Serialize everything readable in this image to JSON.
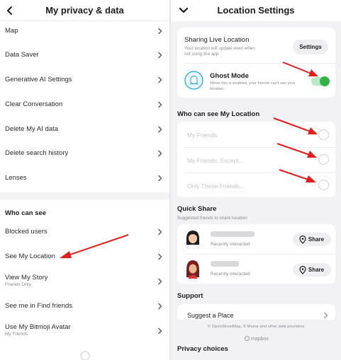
{
  "left": {
    "title": "My privacy & data",
    "items": [
      {
        "label": "Map"
      },
      {
        "label": "Data Saver"
      },
      {
        "label": "Generative AI Settings"
      },
      {
        "label": "Clear Conversation"
      },
      {
        "label": "Delete My AI data"
      },
      {
        "label": "Delete search history"
      },
      {
        "label": "Lenses"
      }
    ],
    "section_title": "Who can see",
    "who_items": [
      {
        "label": "Blocked users",
        "sub": ""
      },
      {
        "label": "See My Location",
        "sub": ""
      },
      {
        "label": "View My Story",
        "sub": "Friends Only"
      },
      {
        "label": "See me in Find friends",
        "sub": ""
      },
      {
        "label": "Use My Bitmoji Avatar",
        "sub": "My Friends"
      }
    ]
  },
  "right": {
    "title": "Location Settings",
    "sharing": {
      "title": "Sharing Live Location",
      "desc": "Your location will update even when not using the app",
      "button": "Settings"
    },
    "ghost": {
      "title": "Ghost Mode",
      "desc": "When this is enabled, your friends can't see your location.",
      "enabled": true
    },
    "who_section": "Who can see My Location",
    "options": [
      "My Friends",
      "My Friends, Except...",
      "Only These Friends..."
    ],
    "quick_share": {
      "title": "Quick Share",
      "subtitle": "Suggested friends to share location",
      "friends": [
        {
          "status": "Recently interacted",
          "button": "Share"
        },
        {
          "status": "Recently interacted",
          "button": "Share"
        }
      ]
    },
    "support": {
      "title": "Support",
      "item": "Suggest a Place"
    },
    "footer": {
      "attribution": "© OpenStreetMap, © Maxar and other data providers",
      "logo": "mapbox",
      "privacy": "Privacy choices"
    }
  },
  "colors": {
    "toggle_on": "#34b24a",
    "annotation_arrow": "#e02020",
    "ghost_icon": "#1aa3e8"
  }
}
